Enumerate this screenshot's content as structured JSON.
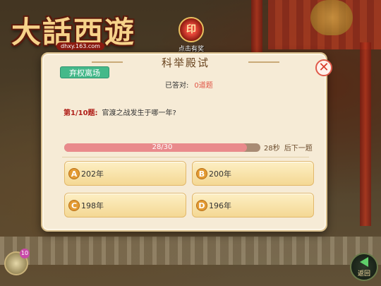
{
  "logo": {
    "title": "大話西遊",
    "url": "dhxy.163.com"
  },
  "top_badge": {
    "icon": "seal-icon",
    "label": "点击有奖"
  },
  "dialog": {
    "title": "科举殿试",
    "tag": "弃权离场",
    "answered_label": "已答对:",
    "answered_count": "0道题",
    "question_number": "第1/10题:",
    "question_text": "官渡之战发生于哪一年?",
    "progress_text": "28/30",
    "progress_fraction": 0.933,
    "timer": "28秒",
    "next_label": "后下一题",
    "options": [
      {
        "letter": "A",
        "text": "202年"
      },
      {
        "letter": "B",
        "text": "200年"
      },
      {
        "letter": "C",
        "text": "198年"
      },
      {
        "letter": "D",
        "text": "196年"
      }
    ]
  },
  "bottom": {
    "avatar_badge": "10",
    "back_label": "返回"
  },
  "colors": {
    "accent_green": "#45b98a",
    "progress_pink": "#e98a8c",
    "option_gold": "#f4d894"
  }
}
